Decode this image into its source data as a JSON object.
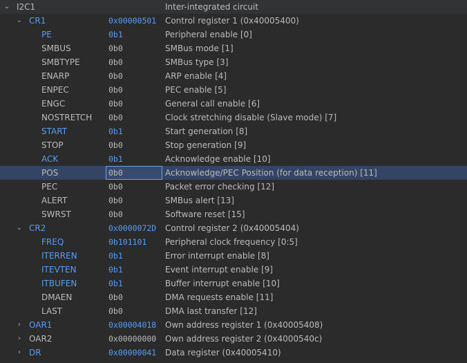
{
  "peripheral": {
    "name": "I2C1",
    "description": "Inter-integrated circuit",
    "expanded": true
  },
  "colors": {
    "background": "#2b2b2b",
    "modified": "#589df6",
    "selected_row": "#344465",
    "text": "#bbbbbb"
  },
  "rows": [
    {
      "level": 1,
      "type": "register",
      "expanded": true,
      "name": "CR1",
      "value": "0x00000501",
      "desc": "Control register 1 (0x40005400)",
      "modified": true
    },
    {
      "level": 2,
      "name": "PE",
      "value": "0b1",
      "desc": "Peripheral enable [0]",
      "modified": true
    },
    {
      "level": 2,
      "name": "SMBUS",
      "value": "0b0",
      "desc": "SMBus mode [1]"
    },
    {
      "level": 2,
      "name": "SMBTYPE",
      "value": "0b0",
      "desc": "SMBus type [3]"
    },
    {
      "level": 2,
      "name": "ENARP",
      "value": "0b0",
      "desc": "ARP enable [4]"
    },
    {
      "level": 2,
      "name": "ENPEC",
      "value": "0b0",
      "desc": "PEC enable [5]"
    },
    {
      "level": 2,
      "name": "ENGC",
      "value": "0b0",
      "desc": "General call enable [6]"
    },
    {
      "level": 2,
      "name": "NOSTRETCH",
      "value": "0b0",
      "desc": "Clock stretching disable (Slave mode) [7]"
    },
    {
      "level": 2,
      "name": "START",
      "value": "0b1",
      "desc": "Start generation [8]",
      "modified": true
    },
    {
      "level": 2,
      "name": "STOP",
      "value": "0b0",
      "desc": "Stop generation [9]"
    },
    {
      "level": 2,
      "name": "ACK",
      "value": "0b1",
      "desc": "Acknowledge enable [10]",
      "modified": true
    },
    {
      "level": 2,
      "name": "POS",
      "value": "0b0",
      "desc": "Acknowledge/PEC Position (for data reception) [11]",
      "selected": true,
      "editing": true
    },
    {
      "level": 2,
      "name": "PEC",
      "value": "0b0",
      "desc": "Packet error checking [12]"
    },
    {
      "level": 2,
      "name": "ALERT",
      "value": "0b0",
      "desc": "SMBus alert [13]"
    },
    {
      "level": 2,
      "name": "SWRST",
      "value": "0b0",
      "desc": "Software reset [15]"
    },
    {
      "level": 1,
      "type": "register",
      "expanded": true,
      "name": "CR2",
      "value": "0x0000072D",
      "desc": "Control register 2 (0x40005404)",
      "modified": true
    },
    {
      "level": 2,
      "name": "FREQ",
      "value": "0b101101",
      "desc": "Peripheral clock frequency [0:5]",
      "modified": true
    },
    {
      "level": 2,
      "name": "ITERREN",
      "value": "0b1",
      "desc": "Error interrupt enable [8]",
      "modified": true
    },
    {
      "level": 2,
      "name": "ITEVTEN",
      "value": "0b1",
      "desc": "Event interrupt enable [9]",
      "modified": true
    },
    {
      "level": 2,
      "name": "ITBUFEN",
      "value": "0b1",
      "desc": "Buffer interrupt enable [10]",
      "modified": true
    },
    {
      "level": 2,
      "name": "DMAEN",
      "value": "0b0",
      "desc": "DMA requests enable [11]"
    },
    {
      "level": 2,
      "name": "LAST",
      "value": "0b0",
      "desc": "DMA last transfer [12]"
    },
    {
      "level": 1,
      "type": "register",
      "expanded": false,
      "name": "OAR1",
      "value": "0x00004018",
      "desc": "Own address register 1 (0x40005408)",
      "modified": true
    },
    {
      "level": 1,
      "type": "register",
      "expanded": false,
      "name": "OAR2",
      "value": "0x00000000",
      "desc": "Own address register 2 (0x4000540c)"
    },
    {
      "level": 1,
      "type": "register",
      "expanded": false,
      "name": "DR",
      "value": "0x00000041",
      "desc": "Data register (0x40005410)",
      "modified": true
    }
  ]
}
